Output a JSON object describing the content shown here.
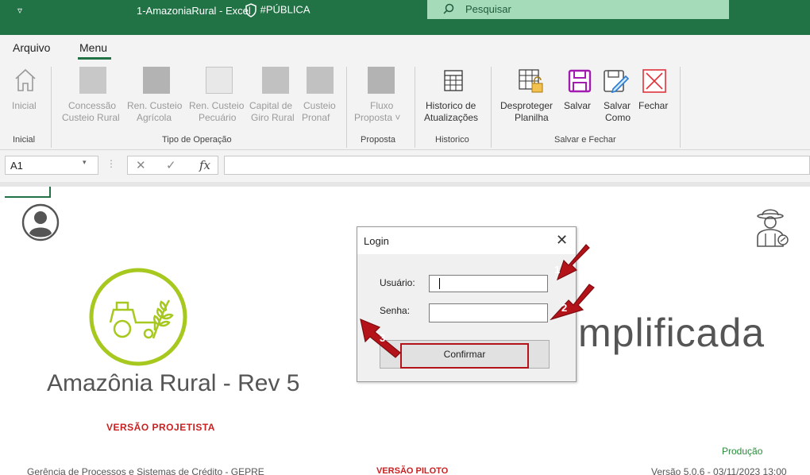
{
  "titlebar": {
    "qat_symbol": "▿",
    "title": "1-AmazoniaRural  -  Excel",
    "classification": "#PÚBLICA",
    "search_placeholder": "Pesquisar"
  },
  "ribbon": {
    "tabs": [
      "Arquivo",
      "Menu"
    ],
    "active_tab": "Menu",
    "buttons": {
      "inicial": "Inicial",
      "concessao": [
        "Concessão",
        "Custeio Rural"
      ],
      "ren_agricola": [
        "Ren. Custeio",
        "Agrícola"
      ],
      "ren_pecuario": [
        "Ren. Custeio",
        "Pecuário"
      ],
      "capital_giro": [
        "Capital de",
        "Giro Rural"
      ],
      "custeio_pronaf": [
        "Custeio",
        "Pronaf"
      ],
      "fluxo": [
        "Fluxo",
        "Proposta ˅"
      ],
      "historico": [
        "Historico de",
        "Atualizações"
      ],
      "desproteger": [
        "Desproteger",
        "Planilha"
      ],
      "salvar": "Salvar",
      "salvar_como": [
        "Salvar",
        "Como"
      ],
      "fechar": "Fechar"
    },
    "groups": {
      "inicial": "Inicial",
      "tipo_operacao": "Tipo de Operação",
      "proposta": "Proposta",
      "historico": "Historico",
      "salvar_fechar": "Salvar e Fechar"
    }
  },
  "formula_bar": {
    "name_box": "A1",
    "fx_label": "fx",
    "formula": ""
  },
  "dialog": {
    "title": "Login",
    "usuario_label": "Usuário:",
    "usuario_value": "",
    "senha_label": "Senha:",
    "senha_value": "",
    "confirm_label": "Confirmar"
  },
  "annotations": {
    "step1": "1",
    "step2": "2",
    "step3": "3",
    "arrow_color": "#b5131a"
  },
  "sheet": {
    "app_name": "Amazônia Rural - Rev 5",
    "versao_projetista": "VERSÃO PROJETISTA",
    "simplificada": "mplificada",
    "footer_left": "Gerência de Processos e Sistemas de Crédito - GEPRE",
    "versao_piloto": "VERSÃO PILOTO",
    "producao": "Produção",
    "versao": "Versão 5.0.6 - 03/11/2023 13:00"
  },
  "colors": {
    "excel_green": "#217346",
    "logo_green": "#a7c81e",
    "red": "#c92121"
  }
}
